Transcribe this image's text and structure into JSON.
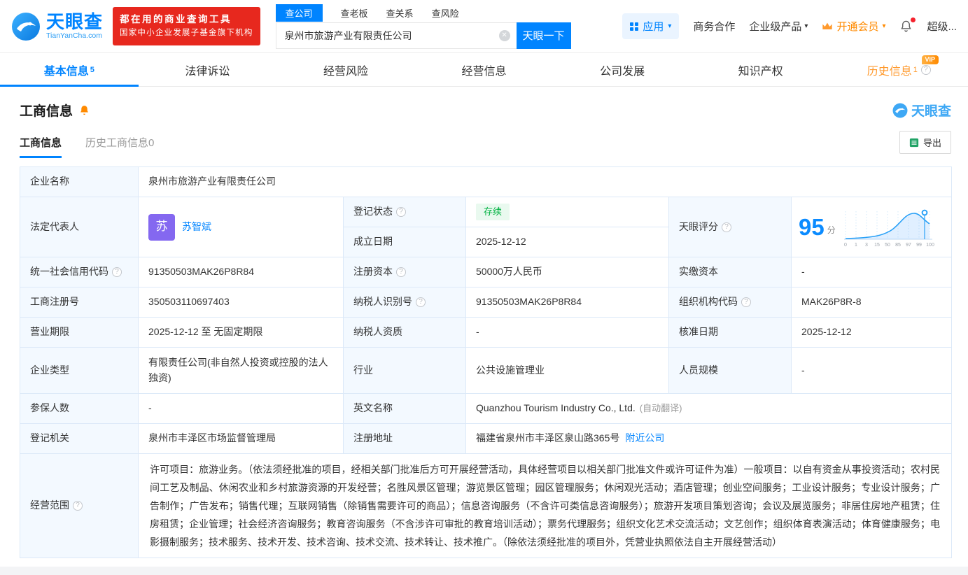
{
  "brand": {
    "name": "天眼查",
    "domain": "TianYanCha.com",
    "promo_line1": "都在用的商业查询工具",
    "promo_line2": "国家中小企业发展子基金旗下机构"
  },
  "search": {
    "tabs": [
      "查公司",
      "查老板",
      "查关系",
      "查风险"
    ],
    "value": "泉州市旅游产业有限责任公司",
    "button": "天眼一下"
  },
  "topnav": {
    "app": "应用",
    "biz": "商务合作",
    "enterprise": "企业级产品",
    "vip": "开通会员",
    "user": "超级..."
  },
  "tabs": {
    "basic": "基本信息",
    "basic_badge": "5",
    "legal": "法律诉讼",
    "risk": "经营风险",
    "operation": "经营信息",
    "development": "公司发展",
    "ip": "知识产权",
    "history": "历史信息",
    "history_badge": "1",
    "history_vip": "VIP"
  },
  "section": {
    "title": "工商信息",
    "watermark": "天眼查",
    "subtab_active": "工商信息",
    "subtab_history": "历史工商信息0",
    "export": "导出"
  },
  "fields": {
    "company_name": {
      "label": "企业名称",
      "value": "泉州市旅游产业有限责任公司"
    },
    "legal_rep": {
      "label": "法定代表人",
      "avatar": "苏",
      "value": "苏智斌"
    },
    "reg_status": {
      "label": "登记状态",
      "value": "存续"
    },
    "est_date": {
      "label": "成立日期",
      "value": "2025-12-12"
    },
    "score": {
      "label": "天眼评分",
      "value": "95",
      "unit": "分"
    },
    "credit_code": {
      "label": "统一社会信用代码",
      "value": "91350503MAK26P8R84"
    },
    "reg_capital": {
      "label": "注册资本",
      "value": "50000万人民币"
    },
    "paid_capital": {
      "label": "实缴资本",
      "value": "-"
    },
    "reg_number": {
      "label": "工商注册号",
      "value": "350503110697403"
    },
    "taxpayer_id": {
      "label": "纳税人识别号",
      "value": "91350503MAK26P8R84"
    },
    "org_code": {
      "label": "组织机构代码",
      "value": "MAK26P8R-8"
    },
    "business_term": {
      "label": "营业期限",
      "value": "2025-12-12 至 无固定期限"
    },
    "taxpayer_quality": {
      "label": "纳税人资质",
      "value": "-"
    },
    "approval_date": {
      "label": "核准日期",
      "value": "2025-12-12"
    },
    "company_type": {
      "label": "企业类型",
      "value": "有限责任公司(非自然人投资或控股的法人独资)"
    },
    "industry": {
      "label": "行业",
      "value": "公共设施管理业"
    },
    "staff_size": {
      "label": "人员规模",
      "value": "-"
    },
    "insured_count": {
      "label": "参保人数",
      "value": "-"
    },
    "english_name": {
      "label": "英文名称",
      "value": "Quanzhou Tourism Industry Co., Ltd.",
      "note": "(自动翻译)"
    },
    "reg_authority": {
      "label": "登记机关",
      "value": "泉州市丰泽区市场监督管理局"
    },
    "reg_address": {
      "label": "注册地址",
      "value": "福建省泉州市丰泽区泉山路365号",
      "link": "附近公司"
    },
    "business_scope": {
      "label": "经营范围",
      "value": "许可项目：旅游业务。（依法须经批准的项目，经相关部门批准后方可开展经营活动，具体经营项目以相关部门批准文件或许可证件为准）一般项目：以自有资金从事投资活动；农村民间工艺及制品、休闲农业和乡村旅游资源的开发经营；名胜风景区管理；游览景区管理；园区管理服务；休闲观光活动；酒店管理；创业空间服务；工业设计服务；专业设计服务；广告制作；广告发布；销售代理；互联网销售（除销售需要许可的商品）；信息咨询服务（不含许可类信息咨询服务）；旅游开发项目策划咨询；会议及展览服务；非居住房地产租赁；住房租赁；企业管理；社会经济咨询服务；教育咨询服务（不含涉许可审批的教育培训活动）；票务代理服务；组织文化艺术交流活动；文艺创作；组织体育表演活动；体育健康服务；电影摄制服务；技术服务、技术开发、技术咨询、技术交流、技术转让、技术推广。（除依法须经批准的项目外，凭营业执照依法自主开展经营活动）"
    }
  },
  "score_chart": {
    "ticks": [
      "0",
      "1",
      "3",
      "15",
      "50",
      "85",
      "97",
      "99",
      "100"
    ]
  },
  "colors": {
    "brand_blue": "#0084ff",
    "orange": "#ff8a00",
    "green": "#00b241",
    "red": "#e7281e"
  }
}
